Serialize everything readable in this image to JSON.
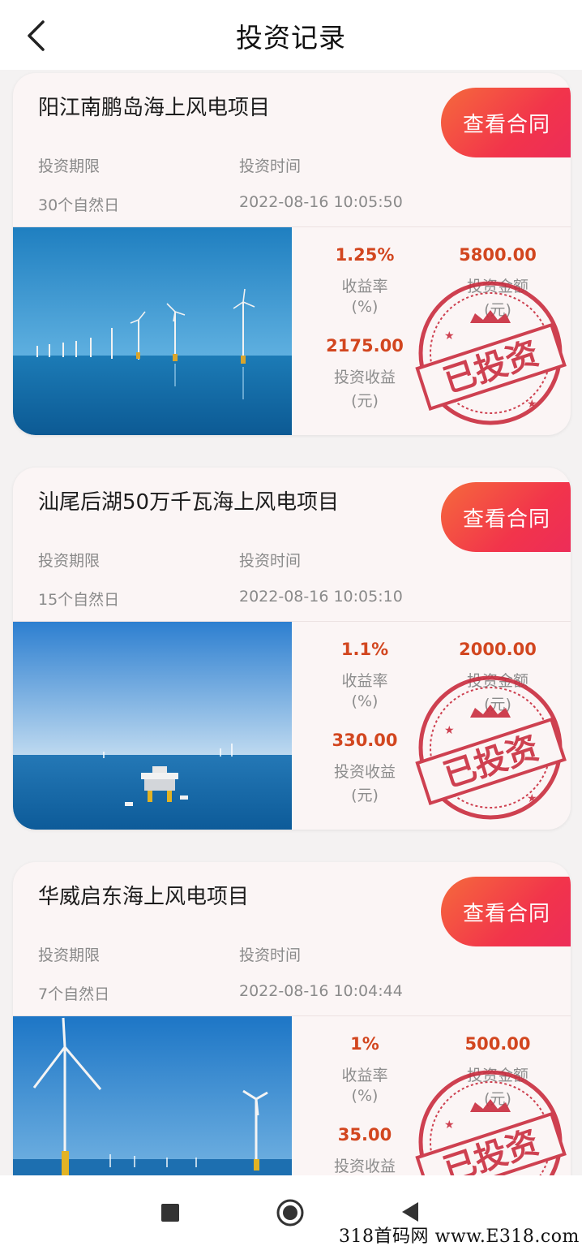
{
  "header": {
    "title": "投资记录"
  },
  "labels": {
    "term_label": "投资期限",
    "time_label": "投资时间",
    "contract_button": "查看合同",
    "rate_label": "收益率",
    "rate_unit": "(%)",
    "amount_label": "投资金额",
    "amount_unit": "(元)",
    "income_label": "投资收益",
    "income_unit": "(元)",
    "stamp_text": "已投资"
  },
  "records": [
    {
      "title": "阳江南鹏岛海上风电项目",
      "term": "30个自然日",
      "time": "2022-08-16 10:05:50",
      "rate": "1.25%",
      "amount": "5800.00",
      "income": "2175.00"
    },
    {
      "title": "汕尾后湖50万千瓦海上风电项目",
      "term": "15个自然日",
      "time": "2022-08-16 10:05:10",
      "rate": "1.1%",
      "amount": "2000.00",
      "income": "330.00"
    },
    {
      "title": "华威启东海上风电项目",
      "term": "7个自然日",
      "time": "2022-08-16 10:04:44",
      "rate": "1%",
      "amount": "500.00",
      "income": "35.00"
    }
  ],
  "watermark": "318首码网 www.E318.com",
  "colors": {
    "accent": "#f2344b",
    "value": "#d2461f",
    "stamp": "#c8283a"
  },
  "icons": [
    "back-arrow-icon",
    "stop-square-icon",
    "home-circle-icon",
    "back-triangle-icon"
  ]
}
